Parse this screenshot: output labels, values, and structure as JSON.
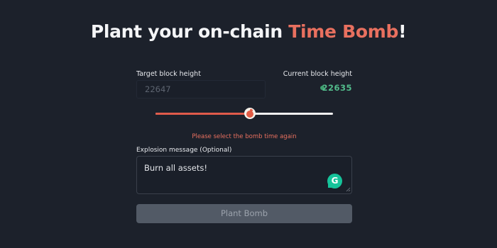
{
  "title": {
    "prefix": "Plant your on-chain ",
    "accent": "Time Bomb",
    "suffix": "!"
  },
  "form": {
    "target_label": "Target block height",
    "target_placeholder": "22647",
    "current_label": "Current block height",
    "current_value": "22635",
    "slider_value": 0.53,
    "error_message": "Please select the bomb time again",
    "message_label": "Explosion message (Optional)",
    "message_value": "Burn all assets!",
    "grammarly_letter": "G",
    "submit_label": "Plant Bomb"
  },
  "colors": {
    "background": "#1c212b",
    "accent": "#e8705f",
    "status_green": "#52bb8b",
    "button_disabled": "#525a66"
  },
  "icons": [
    "bomb-slider-thumb-icon",
    "status-dot-icon",
    "grammarly-icon",
    "resize-handle-icon"
  ]
}
